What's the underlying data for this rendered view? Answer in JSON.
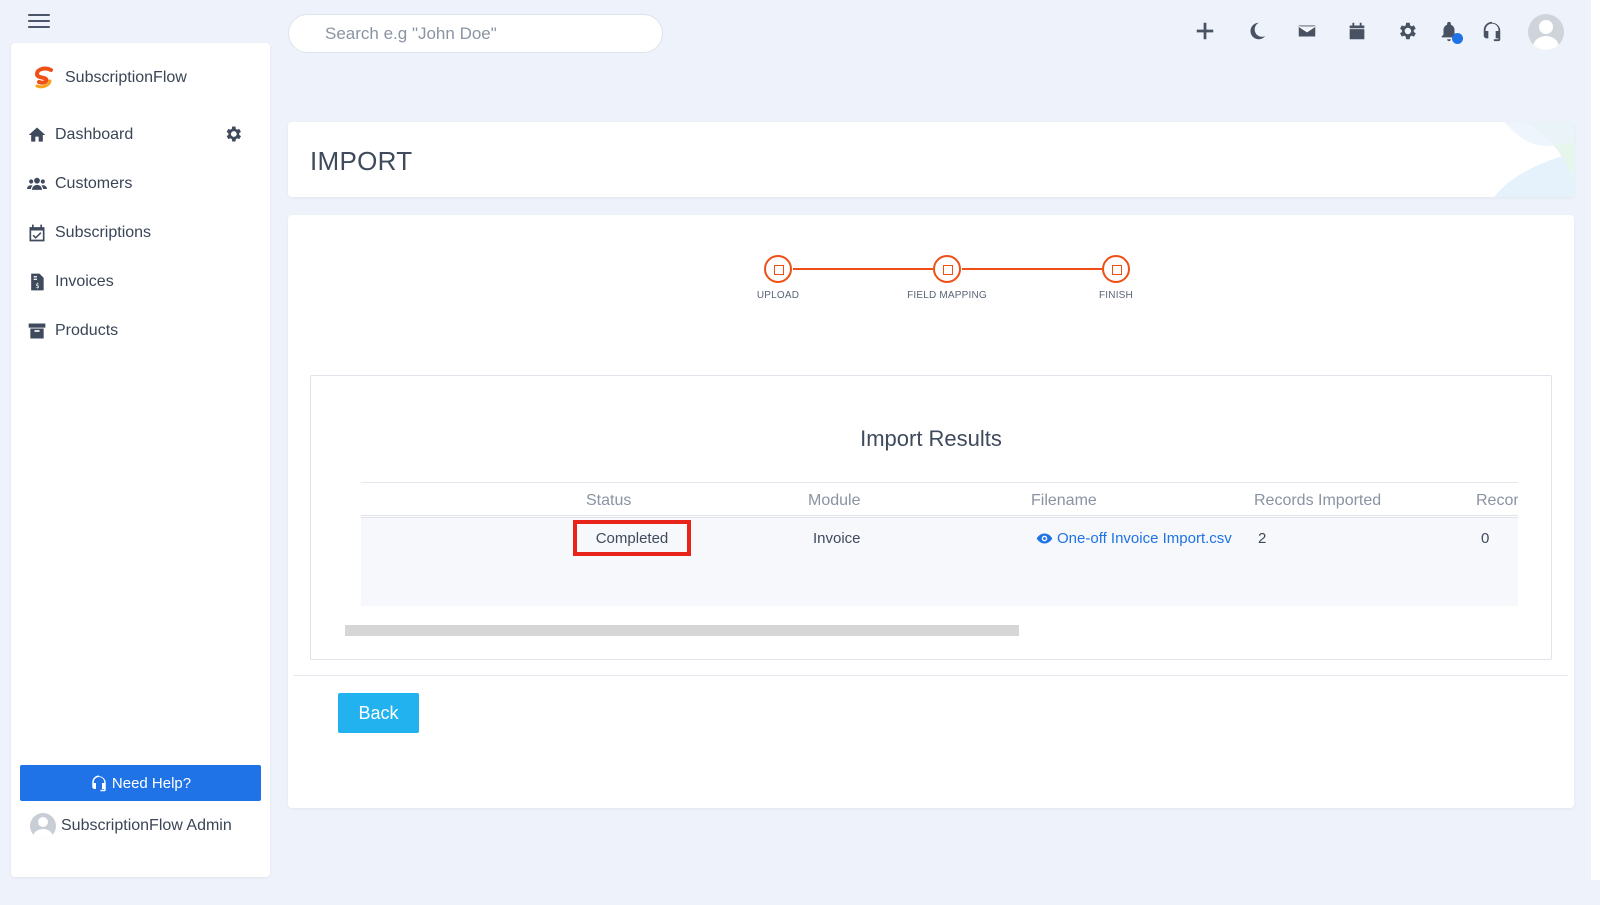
{
  "topbar": {
    "search_placeholder": "Search e.g \"John Doe\"",
    "icons": [
      "plus-icon",
      "moon-icon",
      "mail-icon",
      "calendar-icon",
      "settings-icon",
      "bell-icon",
      "headset-icon"
    ]
  },
  "sidebar": {
    "brand": "SubscriptionFlow",
    "items": [
      {
        "label": "Dashboard",
        "icon": "home-icon"
      },
      {
        "label": "Customers",
        "icon": "users-icon"
      },
      {
        "label": "Subscriptions",
        "icon": "calendar-check-icon"
      },
      {
        "label": "Invoices",
        "icon": "invoice-icon"
      },
      {
        "label": "Products",
        "icon": "archive-icon"
      }
    ],
    "help_label": "Need Help?",
    "admin_name": "SubscriptionFlow Admin"
  },
  "page": {
    "title": "IMPORT"
  },
  "stepper": {
    "steps": [
      "UPLOAD",
      "FIELD MAPPING",
      "FINISH"
    ],
    "accent": "#ef4f16"
  },
  "results": {
    "title": "Import Results",
    "columns": [
      "Status",
      "Module",
      "Filename",
      "Records Imported",
      "Recor"
    ],
    "rows": [
      {
        "status": "Completed",
        "module": "Invoice",
        "filename": "One-off Invoice Import.csv",
        "records_imported": "2",
        "records_other": "0"
      }
    ]
  },
  "actions": {
    "back_label": "Back"
  },
  "colors": {
    "primary": "#1f73e6",
    "back_button": "#22b2f0",
    "highlight_border": "#e8231a"
  }
}
